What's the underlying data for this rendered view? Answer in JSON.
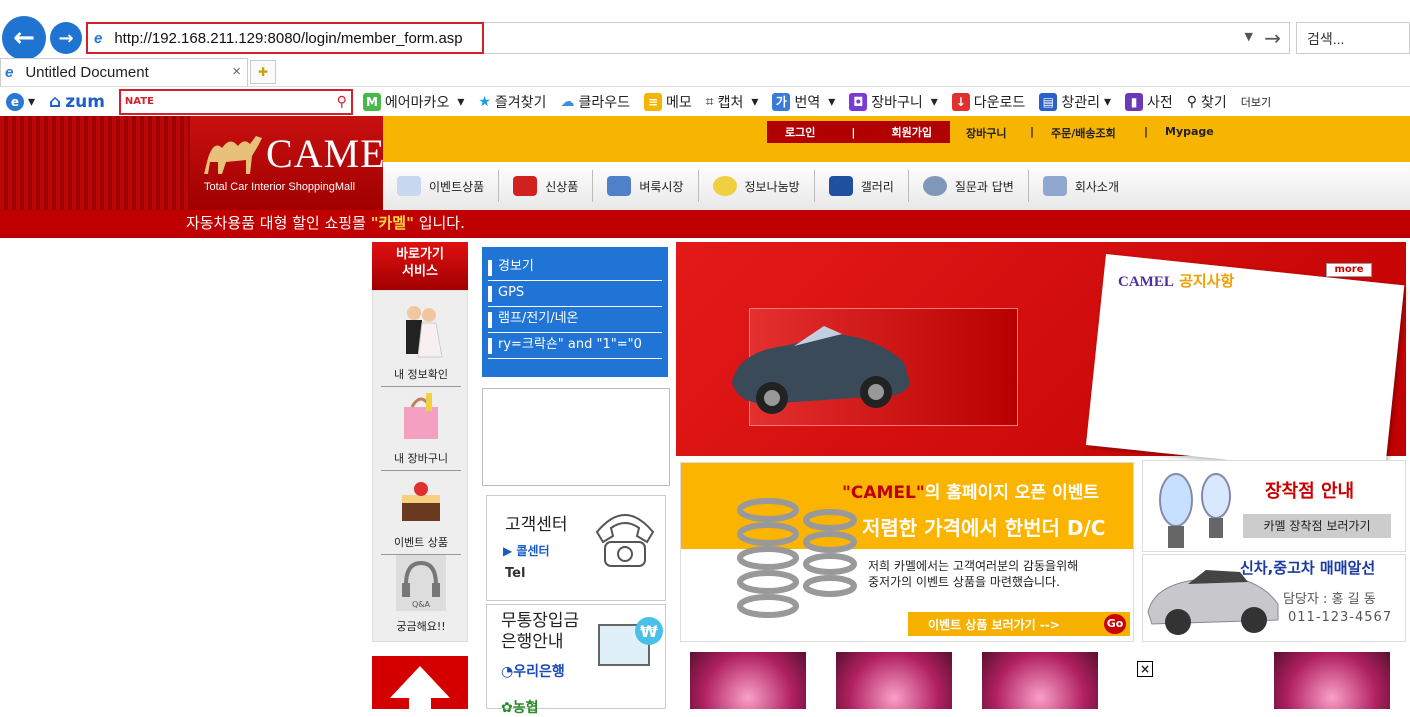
{
  "browser": {
    "url": "http://192.168.211.129:8080/login/member_form.asp",
    "search_placeholder": "검색...",
    "tab_title": "Untitled Document",
    "tab_close": "×",
    "toolbar": {
      "zum": "zum",
      "nate": "NATE",
      "items": [
        "에어마카오",
        "즐겨찾기",
        "클라우드",
        "메모",
        "캡처",
        "번역",
        "장바구니",
        "다운로드",
        "창관리",
        "사전",
        "찾기",
        "더보기"
      ]
    }
  },
  "site": {
    "logo": "CAMEL",
    "logo_sub": "Total Car Interior ShoppingMall",
    "top_links": [
      "로그인",
      "회원가입",
      "장바구니",
      "주문/배송조회",
      "Mypage"
    ],
    "sep": "|",
    "menu": [
      "이벤트상품",
      "신상품",
      "벼룩시장",
      "정보나눔방",
      "갤러리",
      "질문과 답변",
      "회사소개"
    ],
    "ticker_pre": "자동차용품 대형 할인 쇼핑몰 ",
    "ticker_hl": "\"카멜\"",
    "ticker_post": " 입니다.",
    "quick_title_1": "바로가기",
    "quick_title_2": "서비스",
    "quick": [
      "내 정보확인",
      "내 장바구니",
      "이벤트 상품",
      "궁금해요!!"
    ],
    "qa_label": "Q&A",
    "categories": [
      "경보기",
      "GPS",
      "램프/전기/네온",
      "ry=크락숀\" and \"1\"=\"0"
    ],
    "cs_title": "고객센터",
    "cs_call": "콜센터",
    "cs_tel": "Tel",
    "bank_title_1": "무통장입금",
    "bank_title_2": "은행안내",
    "bank_name": "우리은행",
    "bank_name2": "농협",
    "notice_brand": "CAMEL",
    "notice_title": "공지사항",
    "notice_more": "more",
    "event_q": "\"CAMEL\"",
    "event_line1": "의 홈페이지 오픈 이벤트",
    "event_line2": "저렴한 가격에서 한번더 D/C",
    "event_desc_1": "저희 카멜에서는 고객여러분의 감동을위해",
    "event_desc_2": "중저가의 이벤트 상품을 마련했습니다.",
    "event_btn": "이벤트 상품 보러가기 -->",
    "event_go": "Go",
    "shop_title": "장착점 안내",
    "shop_btn": "카멜 장착점 보러가기",
    "car_title": "신차,중고차 매매알선",
    "car_agent": "담당자 : 홍 길 동",
    "car_phone": "011-123-4567",
    "close": "×"
  },
  "colors": {
    "brand_red": "#c00000",
    "nav_yellow": "#f7b400",
    "category_blue": "#1f74d6"
  }
}
